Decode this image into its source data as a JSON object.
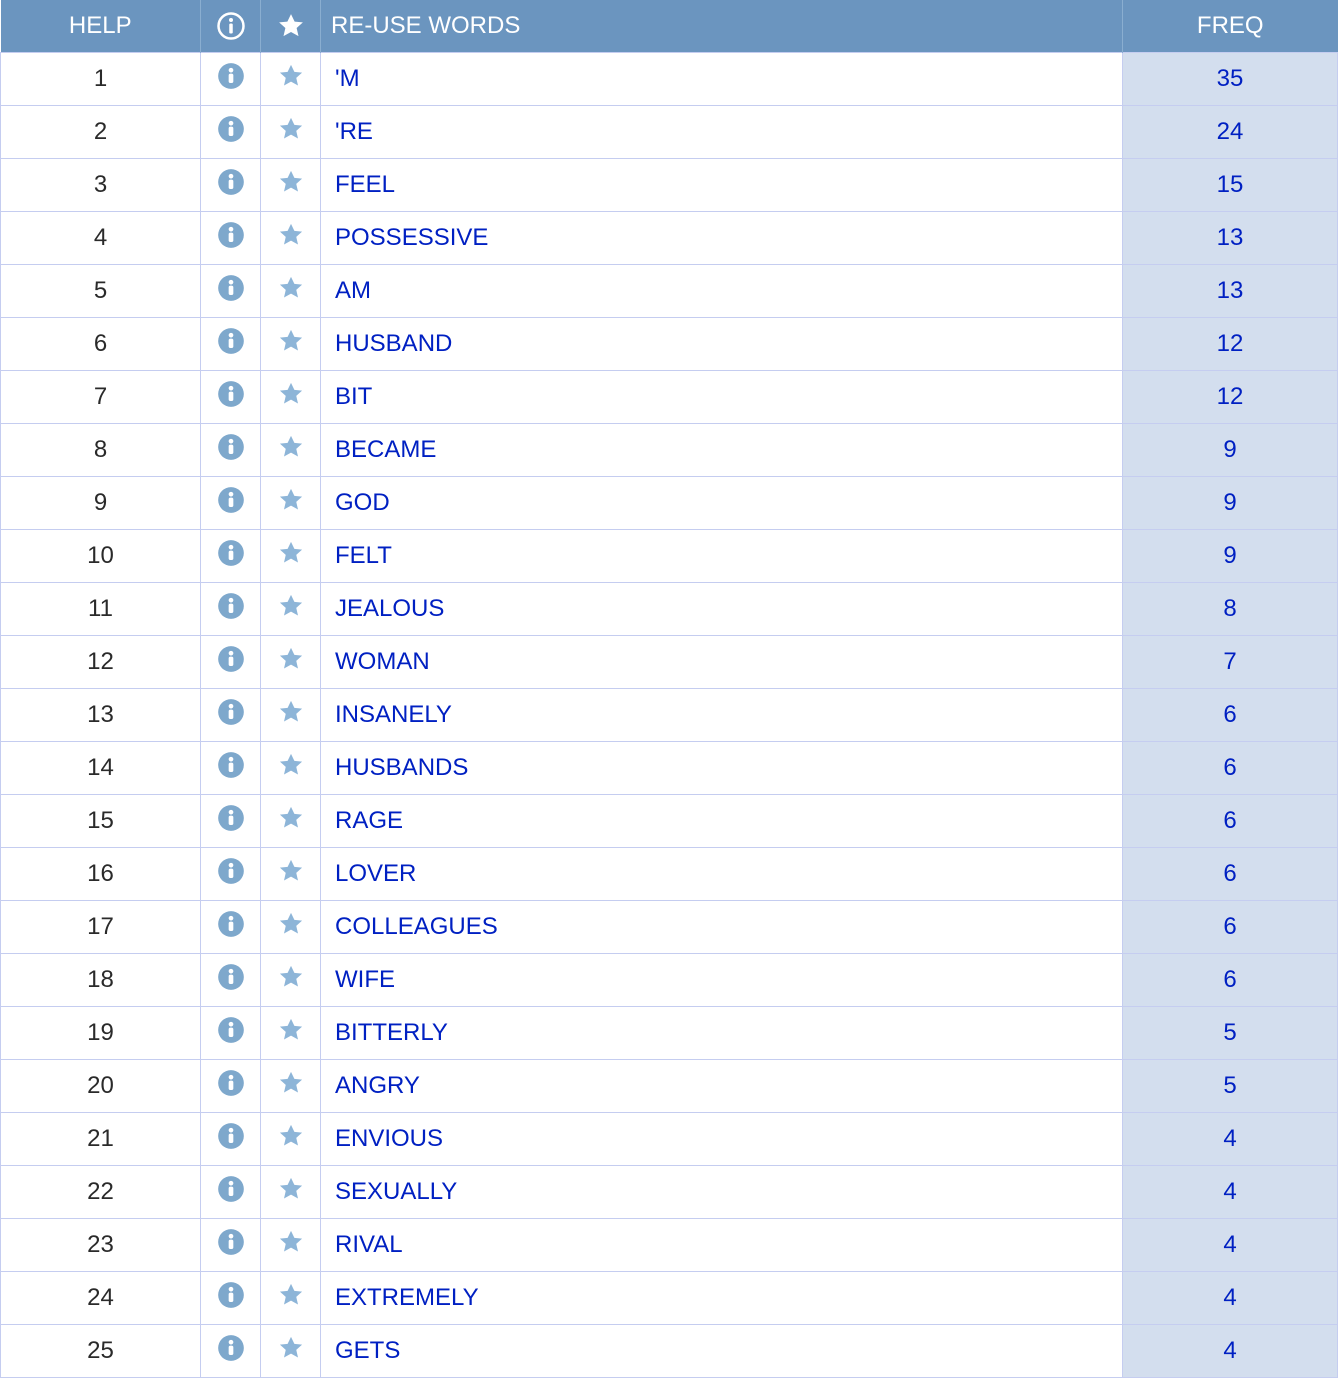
{
  "headers": {
    "help": "HELP",
    "reuse_words": "RE-USE WORDS",
    "freq": "FREQ"
  },
  "rows": [
    {
      "rank": "1",
      "word": "'M",
      "freq": "35"
    },
    {
      "rank": "2",
      "word": "'RE",
      "freq": "24"
    },
    {
      "rank": "3",
      "word": "FEEL",
      "freq": "15"
    },
    {
      "rank": "4",
      "word": "POSSESSIVE",
      "freq": "13"
    },
    {
      "rank": "5",
      "word": "AM",
      "freq": "13"
    },
    {
      "rank": "6",
      "word": "HUSBAND",
      "freq": "12"
    },
    {
      "rank": "7",
      "word": "BIT",
      "freq": "12"
    },
    {
      "rank": "8",
      "word": "BECAME",
      "freq": "9"
    },
    {
      "rank": "9",
      "word": "GOD",
      "freq": "9"
    },
    {
      "rank": "10",
      "word": "FELT",
      "freq": "9"
    },
    {
      "rank": "11",
      "word": "JEALOUS",
      "freq": "8"
    },
    {
      "rank": "12",
      "word": "WOMAN",
      "freq": "7"
    },
    {
      "rank": "13",
      "word": "INSANELY",
      "freq": "6"
    },
    {
      "rank": "14",
      "word": "HUSBANDS",
      "freq": "6"
    },
    {
      "rank": "15",
      "word": "RAGE",
      "freq": "6"
    },
    {
      "rank": "16",
      "word": "LOVER",
      "freq": "6"
    },
    {
      "rank": "17",
      "word": "COLLEAGUES",
      "freq": "6"
    },
    {
      "rank": "18",
      "word": "WIFE",
      "freq": "6"
    },
    {
      "rank": "19",
      "word": "BITTERLY",
      "freq": "5"
    },
    {
      "rank": "20",
      "word": "ANGRY",
      "freq": "5"
    },
    {
      "rank": "21",
      "word": "ENVIOUS",
      "freq": "4"
    },
    {
      "rank": "22",
      "word": "SEXUALLY",
      "freq": "4"
    },
    {
      "rank": "23",
      "word": "RIVAL",
      "freq": "4"
    },
    {
      "rank": "24",
      "word": "EXTREMELY",
      "freq": "4"
    },
    {
      "rank": "25",
      "word": "GETS",
      "freq": "4"
    }
  ]
}
